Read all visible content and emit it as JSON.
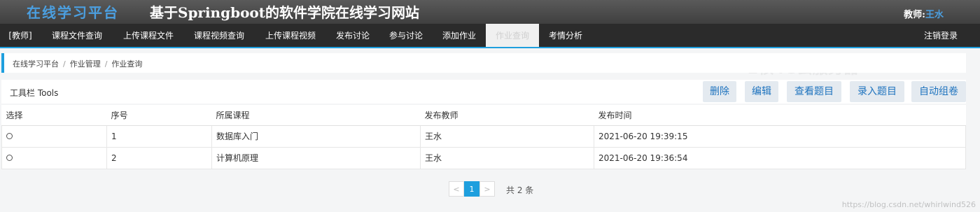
{
  "header": {
    "brand": "在线学习平台",
    "title": "基于Springboot的软件学院在线学习网站",
    "user_label": "教师:",
    "user_name": "王水"
  },
  "nav": {
    "items": [
      {
        "label": "[教师]"
      },
      {
        "label": "课程文件查询"
      },
      {
        "label": "上传课程文件"
      },
      {
        "label": "课程视频查询"
      },
      {
        "label": "上传课程视频"
      },
      {
        "label": "发布讨论"
      },
      {
        "label": "参与讨论"
      },
      {
        "label": "添加作业"
      },
      {
        "label": "作业查询"
      },
      {
        "label": "考情分析"
      }
    ],
    "active_index": 8,
    "logout": "注销登录"
  },
  "breadcrumb": [
    "在线学习平台",
    "作业管理",
    "作业查询"
  ],
  "toolbar": {
    "title": "工具栏 Tools",
    "buttons": [
      "删除",
      "编辑",
      "查看题目",
      "录入题目",
      "自动组卷"
    ]
  },
  "table": {
    "headers": [
      "选择",
      "序号",
      "所属课程",
      "发布教师",
      "发布时间"
    ],
    "rows": [
      {
        "index": "1",
        "course": "数据库入门",
        "teacher": "王水",
        "time": "2021-06-20 19:39:15"
      },
      {
        "index": "2",
        "course": "计算机原理",
        "teacher": "王水",
        "time": "2021-06-20 19:36:54"
      }
    ]
  },
  "pagination": {
    "prev": "<",
    "current": "1",
    "next": ">",
    "total": "共 2 条"
  },
  "background_ad": {
    "headline": "2核4G云服务器"
  },
  "watermark": "https://blog.csdn.net/whirlwind526"
}
